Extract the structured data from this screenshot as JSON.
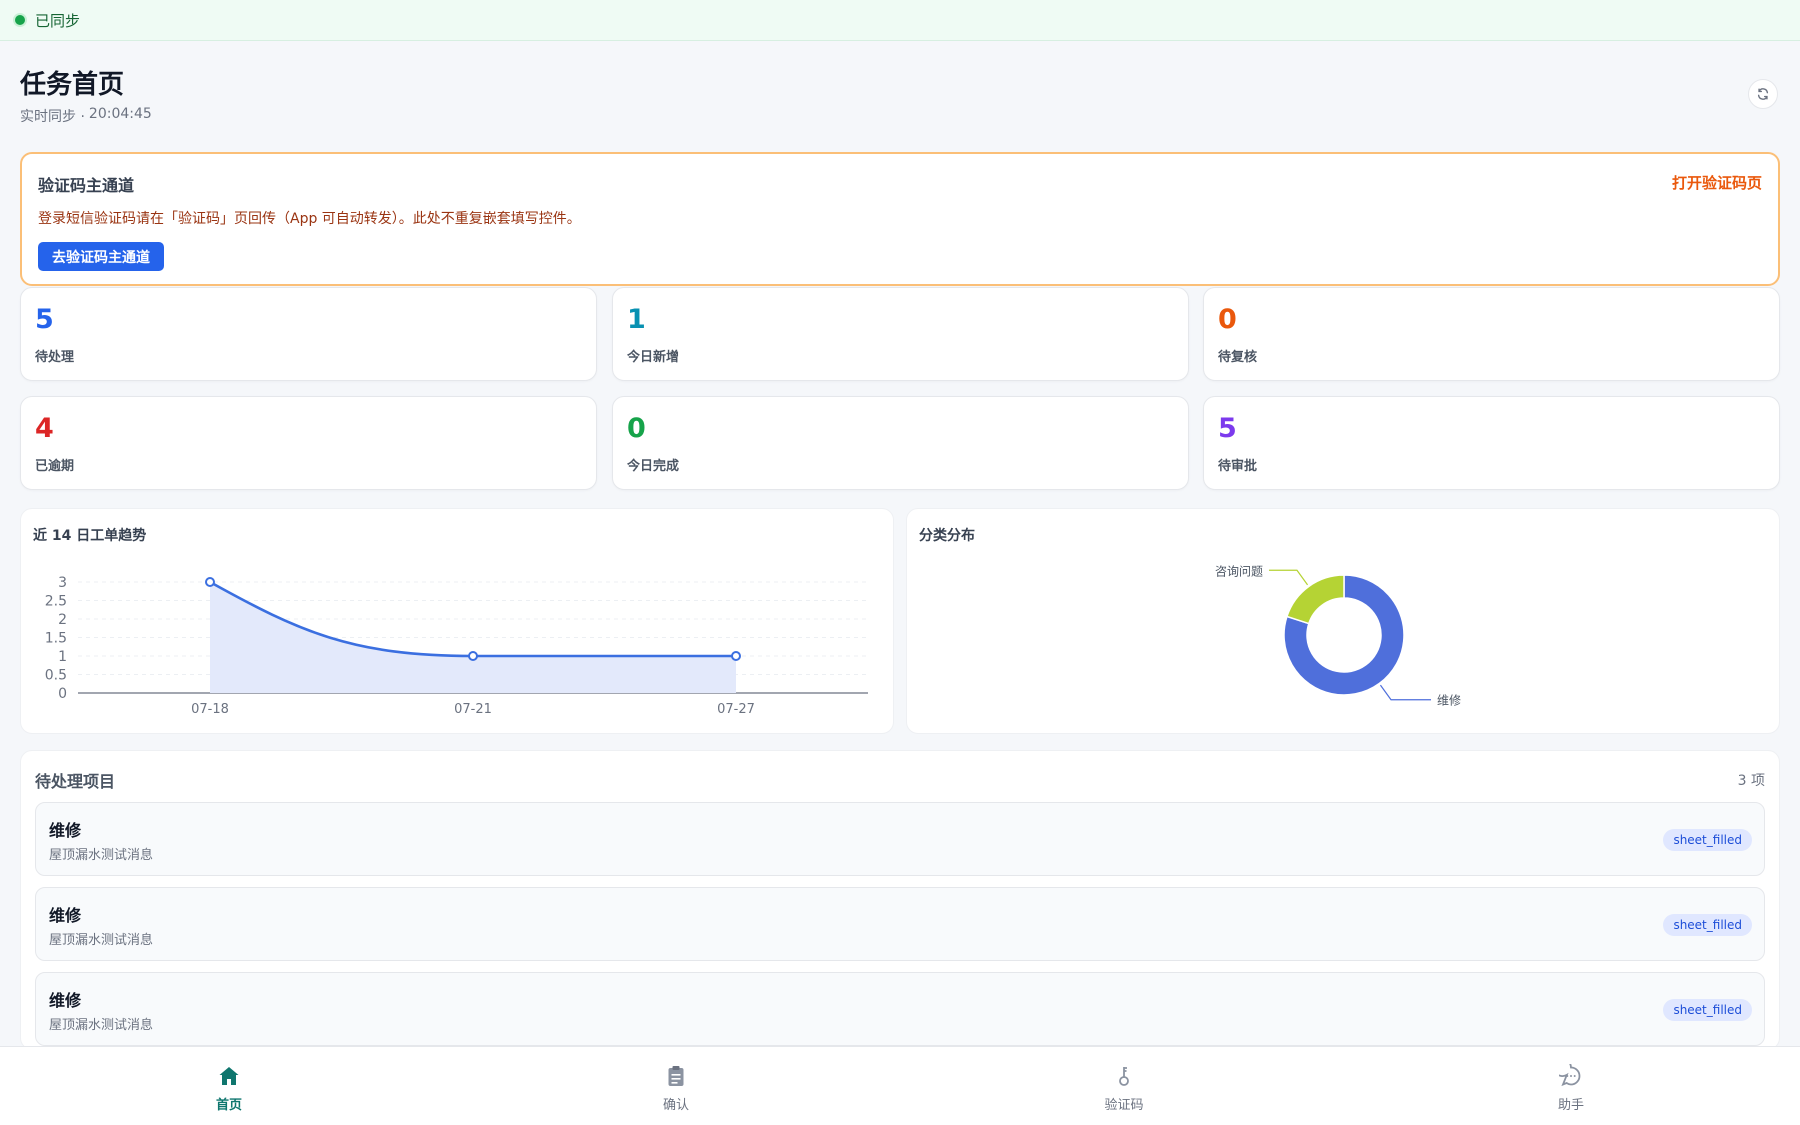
{
  "sync": {
    "status": "已同步"
  },
  "header": {
    "title": "任务首页",
    "sync_label": "实时同步 ·",
    "sync_time": "20:04:45"
  },
  "otp_card": {
    "title": "验证码主通道",
    "link": "打开验证码页",
    "description": "登录短信验证码请在「验证码」页回传（App 可自动转发）。此处不重复嵌套填写控件。",
    "button": "去验证码主通道"
  },
  "stats": [
    {
      "value": "5",
      "label": "待处理",
      "color": "#2563eb"
    },
    {
      "value": "1",
      "label": "今日新增",
      "color": "#0891b2"
    },
    {
      "value": "0",
      "label": "待复核",
      "color": "#ea580c"
    },
    {
      "value": "4",
      "label": "已逾期",
      "color": "#dc2626"
    },
    {
      "value": "0",
      "label": "今日完成",
      "color": "#16a34a"
    },
    {
      "value": "5",
      "label": "待审批",
      "color": "#7c3aed"
    }
  ],
  "chart_data": [
    {
      "type": "line",
      "title": "近 14 日工单趋势",
      "x": [
        "07-18",
        "07-21",
        "07-27"
      ],
      "y_ticks": [
        "0",
        "0.5",
        "1",
        "1.5",
        "2",
        "2.5",
        "3"
      ],
      "ylim": [
        0,
        3
      ],
      "series": [
        {
          "values": [
            3,
            1,
            1
          ]
        }
      ],
      "area_fill": true,
      "colors": {
        "line": "#3b6fe0",
        "area": "#e3e9fb"
      }
    },
    {
      "type": "pie",
      "title": "分类分布",
      "donut": true,
      "slices": [
        {
          "label": "维修",
          "value": 4,
          "color": "#4f6fdb"
        },
        {
          "label": "咨询问题",
          "value": 1,
          "color": "#b5d334"
        }
      ]
    }
  ],
  "pending": {
    "title": "待处理项目",
    "count": "3 项",
    "items": [
      {
        "title": "维修",
        "subtitle": "屋顶漏水测试消息",
        "badge": "sheet_filled"
      },
      {
        "title": "维修",
        "subtitle": "屋顶漏水测试消息",
        "badge": "sheet_filled"
      },
      {
        "title": "维修",
        "subtitle": "屋顶漏水测试消息",
        "badge": "sheet_filled"
      }
    ]
  },
  "nav": {
    "items": [
      {
        "label": "首页",
        "icon": "home-icon",
        "active": true
      },
      {
        "label": "确认",
        "icon": "clipboard-icon",
        "active": false
      },
      {
        "label": "验证码",
        "icon": "key-icon",
        "active": false
      },
      {
        "label": "助手",
        "icon": "chat-icon",
        "active": false
      }
    ]
  }
}
